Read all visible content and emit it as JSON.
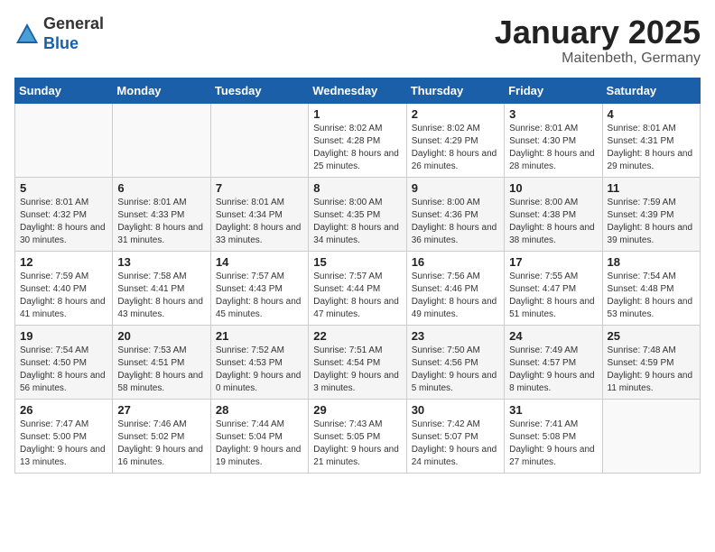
{
  "header": {
    "logo_general": "General",
    "logo_blue": "Blue",
    "title": "January 2025",
    "location": "Maitenbeth, Germany"
  },
  "weekdays": [
    "Sunday",
    "Monday",
    "Tuesday",
    "Wednesday",
    "Thursday",
    "Friday",
    "Saturday"
  ],
  "weeks": [
    [
      {
        "day": "",
        "info": ""
      },
      {
        "day": "",
        "info": ""
      },
      {
        "day": "",
        "info": ""
      },
      {
        "day": "1",
        "info": "Sunrise: 8:02 AM\nSunset: 4:28 PM\nDaylight: 8 hours and 25 minutes."
      },
      {
        "day": "2",
        "info": "Sunrise: 8:02 AM\nSunset: 4:29 PM\nDaylight: 8 hours and 26 minutes."
      },
      {
        "day": "3",
        "info": "Sunrise: 8:01 AM\nSunset: 4:30 PM\nDaylight: 8 hours and 28 minutes."
      },
      {
        "day": "4",
        "info": "Sunrise: 8:01 AM\nSunset: 4:31 PM\nDaylight: 8 hours and 29 minutes."
      }
    ],
    [
      {
        "day": "5",
        "info": "Sunrise: 8:01 AM\nSunset: 4:32 PM\nDaylight: 8 hours and 30 minutes."
      },
      {
        "day": "6",
        "info": "Sunrise: 8:01 AM\nSunset: 4:33 PM\nDaylight: 8 hours and 31 minutes."
      },
      {
        "day": "7",
        "info": "Sunrise: 8:01 AM\nSunset: 4:34 PM\nDaylight: 8 hours and 33 minutes."
      },
      {
        "day": "8",
        "info": "Sunrise: 8:00 AM\nSunset: 4:35 PM\nDaylight: 8 hours and 34 minutes."
      },
      {
        "day": "9",
        "info": "Sunrise: 8:00 AM\nSunset: 4:36 PM\nDaylight: 8 hours and 36 minutes."
      },
      {
        "day": "10",
        "info": "Sunrise: 8:00 AM\nSunset: 4:38 PM\nDaylight: 8 hours and 38 minutes."
      },
      {
        "day": "11",
        "info": "Sunrise: 7:59 AM\nSunset: 4:39 PM\nDaylight: 8 hours and 39 minutes."
      }
    ],
    [
      {
        "day": "12",
        "info": "Sunrise: 7:59 AM\nSunset: 4:40 PM\nDaylight: 8 hours and 41 minutes."
      },
      {
        "day": "13",
        "info": "Sunrise: 7:58 AM\nSunset: 4:41 PM\nDaylight: 8 hours and 43 minutes."
      },
      {
        "day": "14",
        "info": "Sunrise: 7:57 AM\nSunset: 4:43 PM\nDaylight: 8 hours and 45 minutes."
      },
      {
        "day": "15",
        "info": "Sunrise: 7:57 AM\nSunset: 4:44 PM\nDaylight: 8 hours and 47 minutes."
      },
      {
        "day": "16",
        "info": "Sunrise: 7:56 AM\nSunset: 4:46 PM\nDaylight: 8 hours and 49 minutes."
      },
      {
        "day": "17",
        "info": "Sunrise: 7:55 AM\nSunset: 4:47 PM\nDaylight: 8 hours and 51 minutes."
      },
      {
        "day": "18",
        "info": "Sunrise: 7:54 AM\nSunset: 4:48 PM\nDaylight: 8 hours and 53 minutes."
      }
    ],
    [
      {
        "day": "19",
        "info": "Sunrise: 7:54 AM\nSunset: 4:50 PM\nDaylight: 8 hours and 56 minutes."
      },
      {
        "day": "20",
        "info": "Sunrise: 7:53 AM\nSunset: 4:51 PM\nDaylight: 8 hours and 58 minutes."
      },
      {
        "day": "21",
        "info": "Sunrise: 7:52 AM\nSunset: 4:53 PM\nDaylight: 9 hours and 0 minutes."
      },
      {
        "day": "22",
        "info": "Sunrise: 7:51 AM\nSunset: 4:54 PM\nDaylight: 9 hours and 3 minutes."
      },
      {
        "day": "23",
        "info": "Sunrise: 7:50 AM\nSunset: 4:56 PM\nDaylight: 9 hours and 5 minutes."
      },
      {
        "day": "24",
        "info": "Sunrise: 7:49 AM\nSunset: 4:57 PM\nDaylight: 9 hours and 8 minutes."
      },
      {
        "day": "25",
        "info": "Sunrise: 7:48 AM\nSunset: 4:59 PM\nDaylight: 9 hours and 11 minutes."
      }
    ],
    [
      {
        "day": "26",
        "info": "Sunrise: 7:47 AM\nSunset: 5:00 PM\nDaylight: 9 hours and 13 minutes."
      },
      {
        "day": "27",
        "info": "Sunrise: 7:46 AM\nSunset: 5:02 PM\nDaylight: 9 hours and 16 minutes."
      },
      {
        "day": "28",
        "info": "Sunrise: 7:44 AM\nSunset: 5:04 PM\nDaylight: 9 hours and 19 minutes."
      },
      {
        "day": "29",
        "info": "Sunrise: 7:43 AM\nSunset: 5:05 PM\nDaylight: 9 hours and 21 minutes."
      },
      {
        "day": "30",
        "info": "Sunrise: 7:42 AM\nSunset: 5:07 PM\nDaylight: 9 hours and 24 minutes."
      },
      {
        "day": "31",
        "info": "Sunrise: 7:41 AM\nSunset: 5:08 PM\nDaylight: 9 hours and 27 minutes."
      },
      {
        "day": "",
        "info": ""
      }
    ]
  ]
}
